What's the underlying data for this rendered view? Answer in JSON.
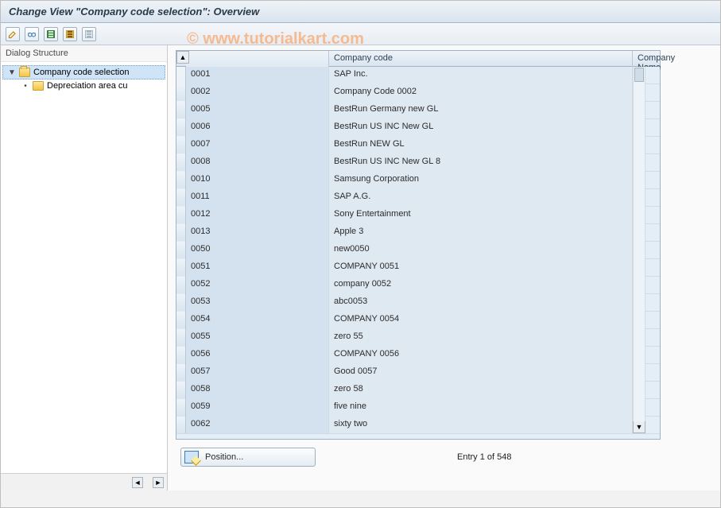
{
  "title": "Change View \"Company code selection\": Overview",
  "watermark": "© www.tutorialkart.com",
  "toolbar": {
    "icons": [
      {
        "name": "toggle-display-change-icon"
      },
      {
        "name": "glasses-icon"
      },
      {
        "name": "select-all-icon"
      },
      {
        "name": "select-block-icon"
      },
      {
        "name": "deselect-all-icon"
      }
    ]
  },
  "sidebar": {
    "header": "Dialog Structure",
    "tree": [
      {
        "label": "Company code selection",
        "selected": true,
        "open": true,
        "level": 0
      },
      {
        "label": "Depreciation area cu",
        "selected": false,
        "open": false,
        "level": 1
      }
    ]
  },
  "grid": {
    "columns": {
      "code": "Company code",
      "name": "Company Name"
    },
    "rows": [
      {
        "code": "0001",
        "name": "SAP Inc."
      },
      {
        "code": "0002",
        "name": "Company Code 0002"
      },
      {
        "code": "0005",
        "name": "BestRun Germany new GL"
      },
      {
        "code": "0006",
        "name": "BestRun US INC New GL"
      },
      {
        "code": "0007",
        "name": "BestRun NEW GL"
      },
      {
        "code": "0008",
        "name": "BestRun US INC New GL 8"
      },
      {
        "code": "0010",
        "name": "Samsung Corporation"
      },
      {
        "code": "0011",
        "name": "SAP A.G."
      },
      {
        "code": "0012",
        "name": "Sony Entertainment"
      },
      {
        "code": "0013",
        "name": "Apple 3"
      },
      {
        "code": "0050",
        "name": "new0050"
      },
      {
        "code": "0051",
        "name": "COMPANY 0051"
      },
      {
        "code": "0052",
        "name": "company 0052"
      },
      {
        "code": "0053",
        "name": "abc0053"
      },
      {
        "code": "0054",
        "name": "COMPANY 0054"
      },
      {
        "code": "0055",
        "name": "zero 55"
      },
      {
        "code": "0056",
        "name": "COMPANY 0056"
      },
      {
        "code": "0057",
        "name": "Good 0057"
      },
      {
        "code": "0058",
        "name": "zero 58"
      },
      {
        "code": "0059",
        "name": "five nine"
      },
      {
        "code": "0062",
        "name": "sixty two"
      }
    ]
  },
  "footer": {
    "position_label": "Position...",
    "entry_text": "Entry 1 of 548"
  }
}
